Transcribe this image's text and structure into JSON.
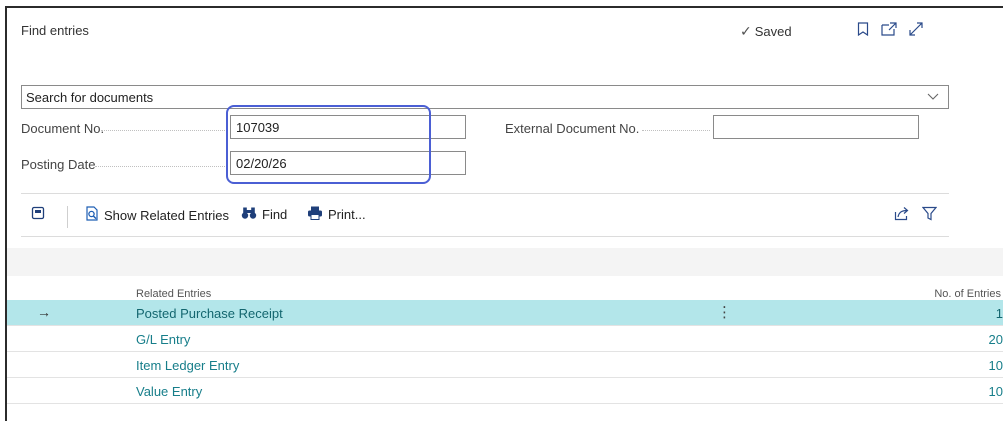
{
  "window": {
    "title": "Find entries",
    "saved_label": "Saved",
    "saved_icon": "checkmark-icon",
    "icons": [
      "bookmark-icon",
      "open-new-window-icon",
      "expand-icon"
    ]
  },
  "search": {
    "value": "Search for documents",
    "icon": "chevron-down-icon"
  },
  "fields": {
    "document_no_label": "Document No.",
    "document_no_value": "107039",
    "posting_date_label": "Posting Date",
    "posting_date_value": "02/20/26",
    "external_document_no_label": "External Document No.",
    "external_document_no_value": ""
  },
  "toolbar": {
    "show_related_label": "Show Related Entries",
    "find_label": "Find",
    "print_label": "Print...",
    "icons": [
      "navigate-icon",
      "show-related-icon",
      "binoculars-icon",
      "printer-icon",
      "share-icon",
      "filter-icon"
    ]
  },
  "table": {
    "col_related": "Related Entries",
    "col_count": "No. of Entries",
    "rows": [
      {
        "name": "Posted Purchase Receipt",
        "count": "1",
        "selected": true
      },
      {
        "name": "G/L Entry",
        "count": "20",
        "selected": false
      },
      {
        "name": "Item Ledger Entry",
        "count": "10",
        "selected": false
      },
      {
        "name": "Value Entry",
        "count": "10",
        "selected": false
      }
    ]
  },
  "colors": {
    "accent": "#177e8a",
    "selected_row": "#b3e6ea",
    "highlight_border": "#4b5fd4"
  }
}
